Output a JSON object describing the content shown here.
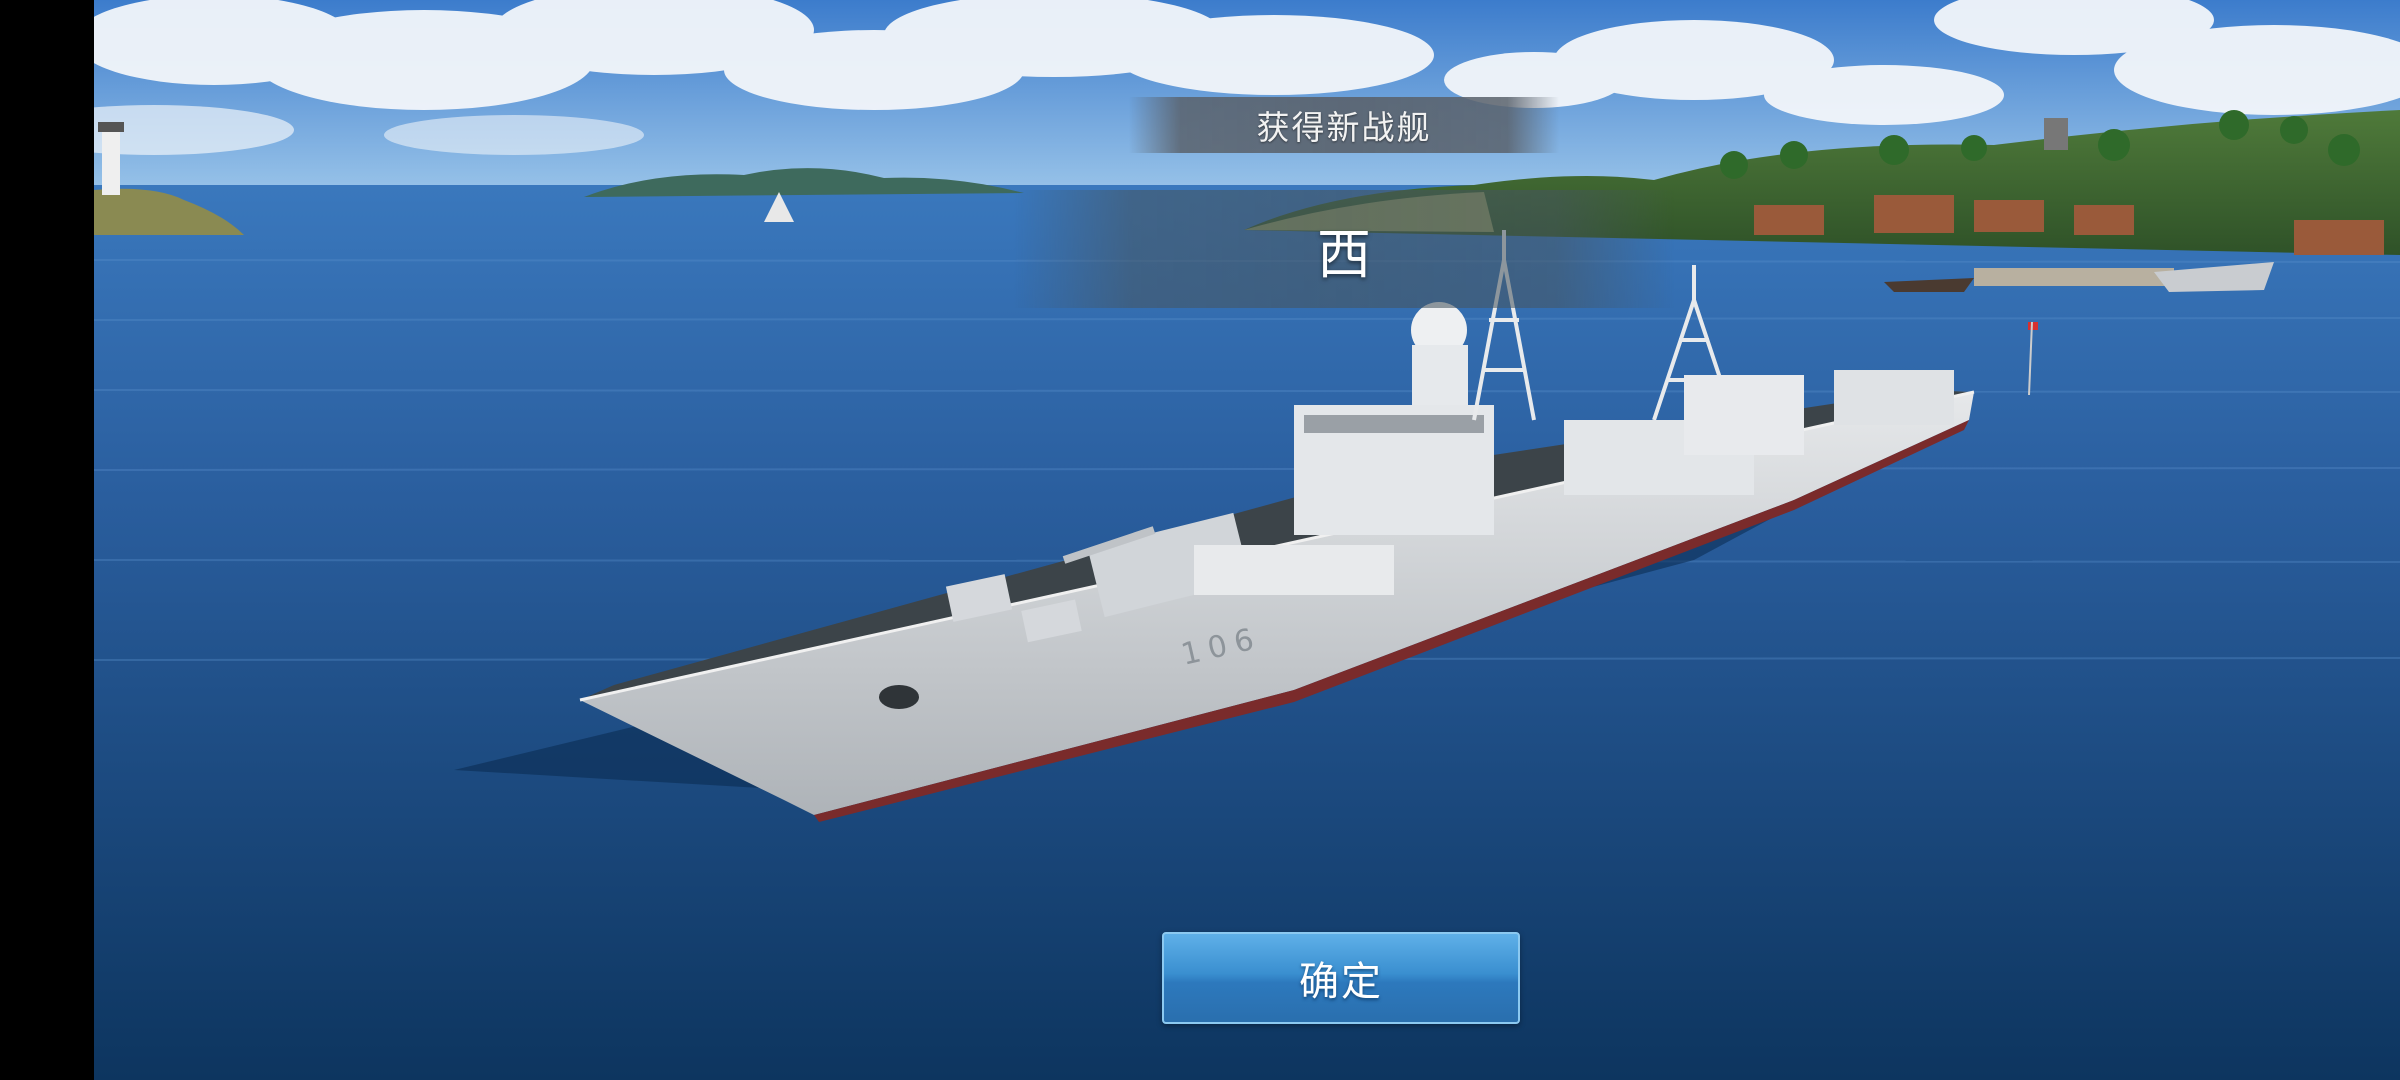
{
  "dialog": {
    "title": "获得新战舰",
    "ship_name": "西",
    "confirm_label": "确定"
  },
  "scene": {
    "hull_number": "106",
    "colors": {
      "sky_top": "#3a78c8",
      "sea_far": "#2b62a6",
      "sea_near": "#0f3a6b",
      "hull": "#d9dcdf",
      "deck": "#3c4449",
      "button": "#3a8fd0"
    }
  }
}
